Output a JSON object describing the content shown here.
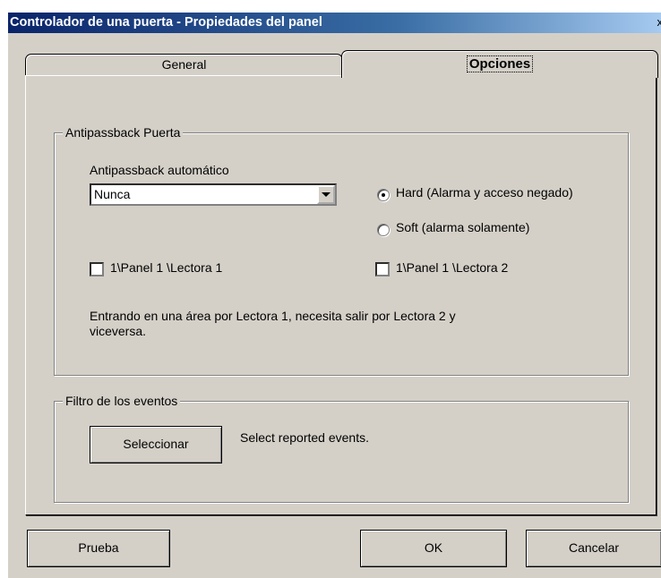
{
  "window": {
    "title": "Controlador de una puerta - Propiedades del panel"
  },
  "tabs": [
    {
      "label": "General",
      "active": false
    },
    {
      "label": "Opciones",
      "active": true
    }
  ],
  "antipassback": {
    "group_label": "Antipassback Puerta",
    "auto_label": "Antipassback automático",
    "auto_value": "Nunca",
    "radio_hard": "Hard (Alarma y acceso negado)",
    "radio_soft": "Soft (alarma solamente)",
    "radio_selected": "hard",
    "reader1_label": "1\\Panel  1 \\Lectora  1",
    "reader1_checked": false,
    "reader2_label": "1\\Panel  1 \\Lectora  2",
    "reader2_checked": false,
    "note_line1": "Entrando en una área por Lectora 1, necesita salir por Lectora 2 y",
    "note_line2": "viceversa."
  },
  "events": {
    "group_label": "Filtro de los eventos",
    "select_button": "Seleccionar",
    "description": "Select reported events."
  },
  "footer": {
    "test_button": "Prueba",
    "ok_button": "OK",
    "cancel_button": "Cancelar"
  },
  "close_glyph": "x"
}
